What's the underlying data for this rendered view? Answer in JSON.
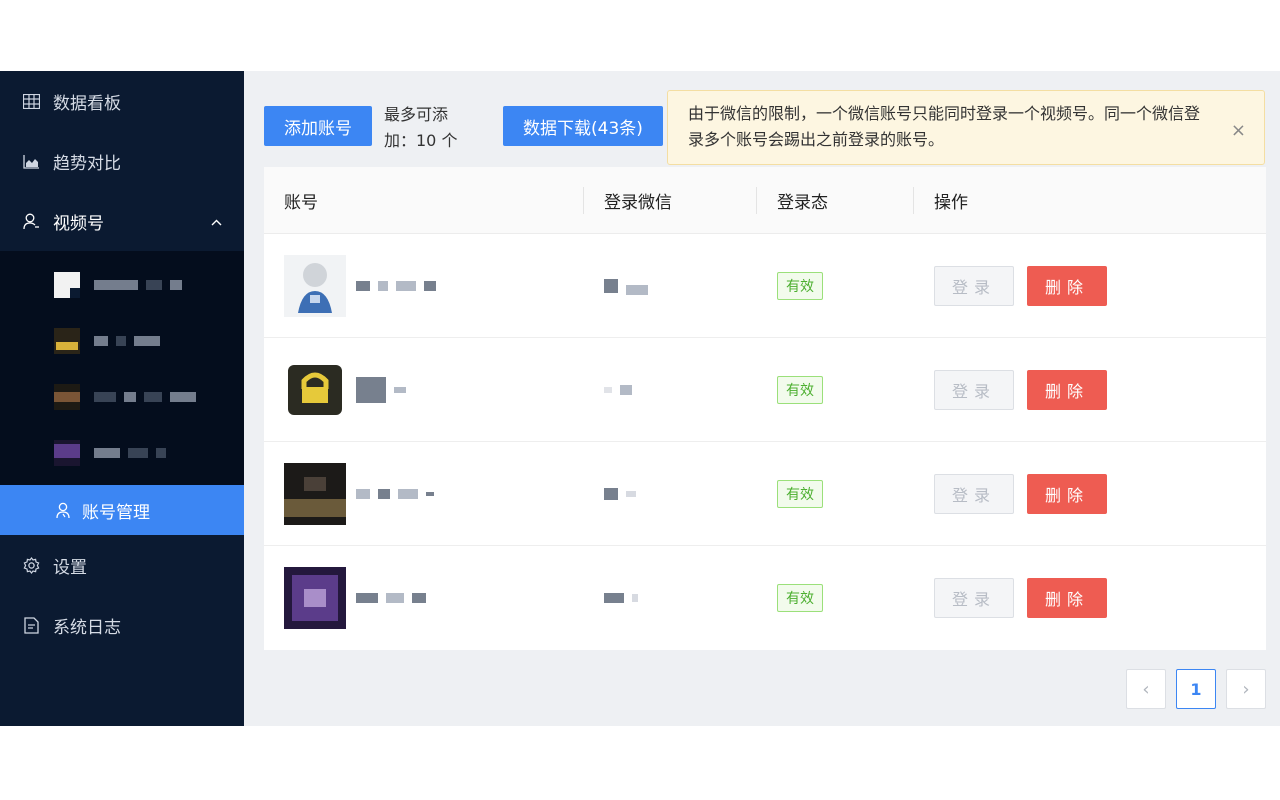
{
  "sidebar": {
    "items": [
      {
        "label": "数据看板",
        "icon": "grid-icon"
      },
      {
        "label": "趋势对比",
        "icon": "area-chart-icon"
      },
      {
        "label": "视频号",
        "icon": "user-icon"
      },
      {
        "label": "账号管理",
        "icon": "users-icon"
      },
      {
        "label": "设置",
        "icon": "gear-icon"
      },
      {
        "label": "系统日志",
        "icon": "document-icon"
      }
    ],
    "channel_accounts": [
      {
        "thumb_color": "#e8e8e8"
      },
      {
        "thumb_color": "#3a2f1a"
      },
      {
        "thumb_color": "#6b4a2e"
      },
      {
        "thumb_color": "#4a2f6b"
      }
    ]
  },
  "toolbar": {
    "add_label": "添加账号",
    "limit_line1": "最多可添",
    "limit_line2": "加：10 个",
    "download_label": "数据下载(43条)"
  },
  "notice": {
    "text": "由于微信的限制，一个微信账号只能同时登录一个视频号。同一个微信登录多个账号会踢出之前登录的账号。",
    "close": "×"
  },
  "table": {
    "headers": [
      "账号",
      "登录微信",
      "登录态",
      "操作"
    ],
    "rows": [
      {
        "avatar_color": "#dfe6ef",
        "status": "有效",
        "login": "登录",
        "delete": "删除"
      },
      {
        "avatar_color": "#2b2b22",
        "status": "有效",
        "login": "登录",
        "delete": "删除"
      },
      {
        "avatar_color": "#3b3128",
        "status": "有效",
        "login": "登录",
        "delete": "删除"
      },
      {
        "avatar_color": "#3a2a5c",
        "status": "有效",
        "login": "登录",
        "delete": "删除"
      }
    ]
  },
  "pagination": {
    "prev": "‹",
    "current": "1",
    "next": "›"
  },
  "colors": {
    "primary": "#3c86f3",
    "danger": "#ee5c52",
    "sidebar_bg": "#0b1a31",
    "success": "#4caf2f"
  }
}
